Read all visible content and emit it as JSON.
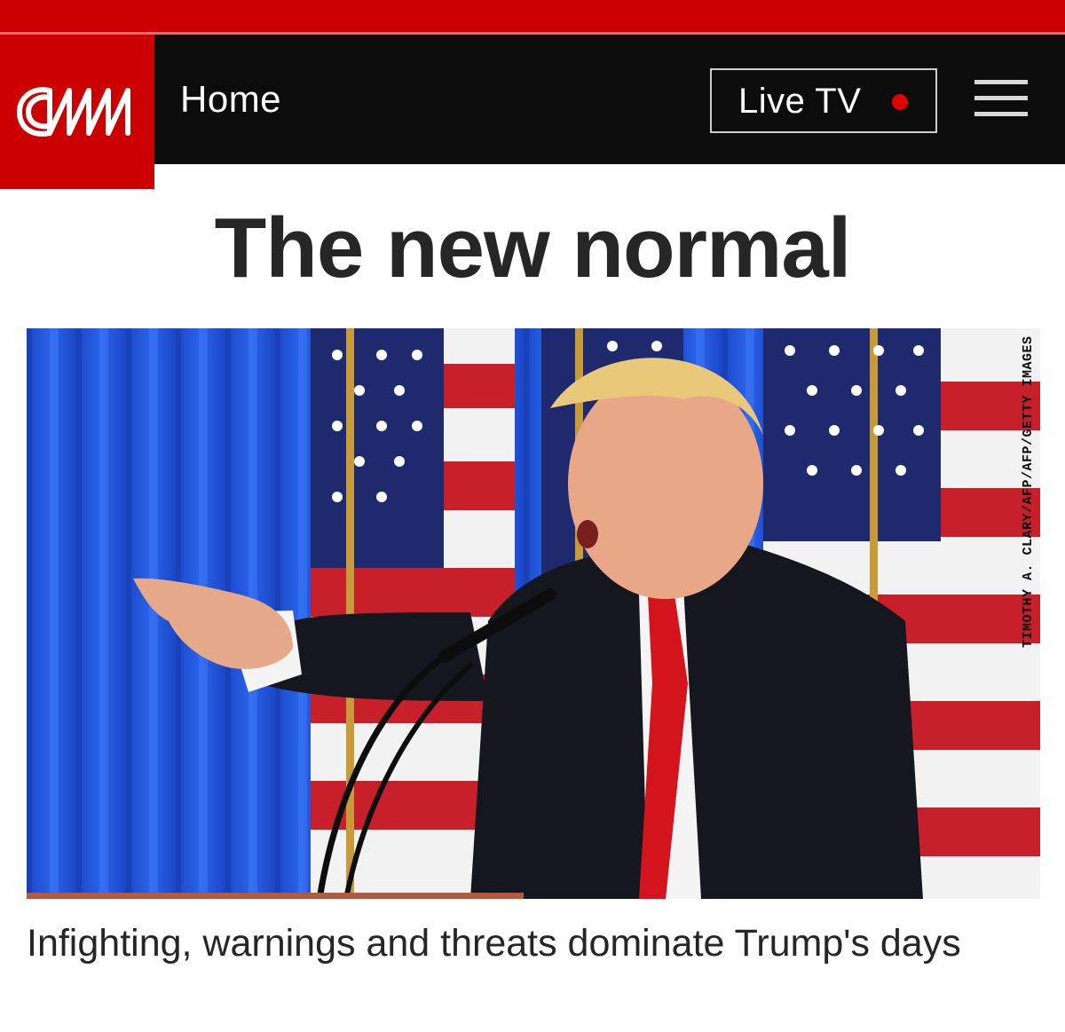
{
  "header": {
    "logo_text": "CNN",
    "nav_label": "Home",
    "live_tv_label": "Live TV",
    "menu_icon": "hamburger-menu-icon"
  },
  "colors": {
    "brand_red": "#cc0000",
    "nav_background": "#0c0c0c",
    "live_dot": "#e00000",
    "headline_text": "#262626"
  },
  "article": {
    "section_headline": "The new normal",
    "photo_credit": "TIMOTHY A. CLARY/AFP/AFP/GETTY IMAGES",
    "caption": "Infighting, warnings and threats dominate Trump's days"
  }
}
